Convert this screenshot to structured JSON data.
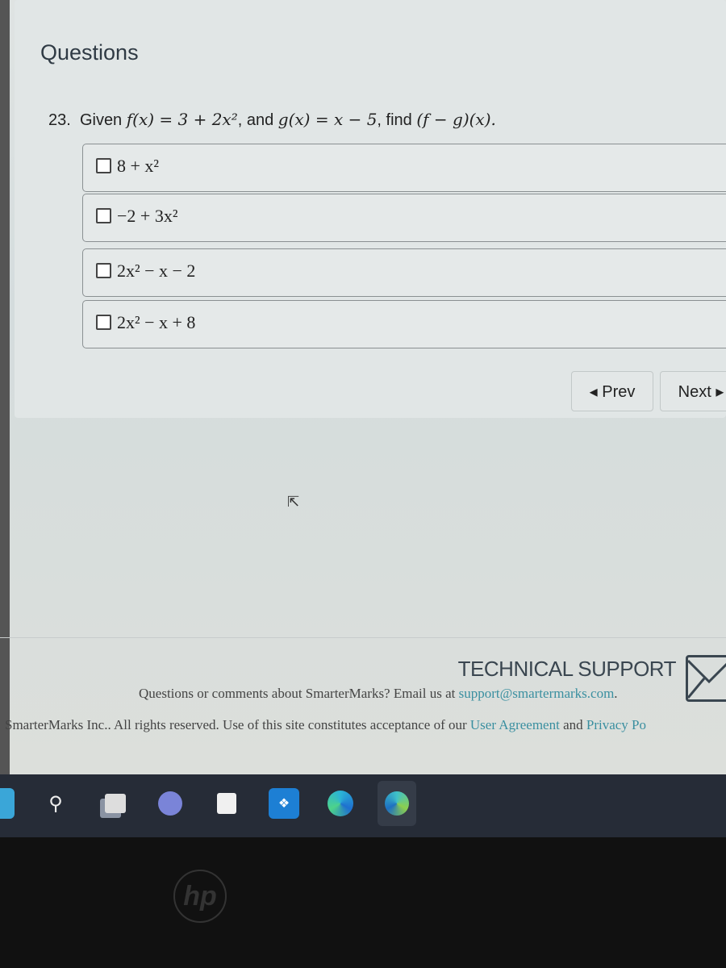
{
  "page": {
    "title": "Questions"
  },
  "question": {
    "number": "23.",
    "text_prefix": "Given ",
    "f_def": "f(x) = 3 + 2x²",
    "mid": ", and ",
    "g_def": "g(x) = x − 5",
    "find": ", find ",
    "target": "(f − g)(x)."
  },
  "options": [
    {
      "label": "8 + x²",
      "checked": false
    },
    {
      "label": "−2 + 3x²",
      "checked": false
    },
    {
      "label": "2x² − x − 2",
      "checked": false
    },
    {
      "label": "2x² − x + 8",
      "checked": false
    }
  ],
  "nav": {
    "prev": "◂ Prev",
    "next": "Next ▸"
  },
  "footer": {
    "support_title": "TECHNICAL SUPPORT",
    "contact_text": "Questions or comments about SmarterMarks? Email us at ",
    "email": "support@smartermarks.com",
    "period": ".",
    "rights": "SmarterMarks Inc.. All rights reserved. Use of this site constitutes acceptance of our ",
    "user_agreement": "User Agreement",
    "and": " and ",
    "privacy": "Privacy Po"
  },
  "taskbar": {
    "icons": [
      "windows-start",
      "search",
      "task-view",
      "teams-chat",
      "microsoft-store",
      "dropbox",
      "edge",
      "edge-beta"
    ]
  },
  "device": {
    "logo": "hp"
  }
}
